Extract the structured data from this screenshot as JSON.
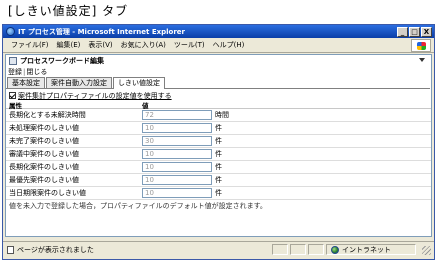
{
  "caption": "[しきい値設定] タブ",
  "window": {
    "title": "IT プロセス管理 - Microsoft Internet Explorer",
    "minimize": "_",
    "maximize": "□",
    "close": "X"
  },
  "menu": [
    "ファイル(F)",
    "編集(E)",
    "表示(V)",
    "お気に入り(A)",
    "ツール(T)",
    "ヘルプ(H)"
  ],
  "editor": {
    "title": "プロセスワークボード編集",
    "register_label": "登録",
    "close_label": "閉じる"
  },
  "tabs": [
    "基本設定",
    "案件自動入力設定",
    "しきい値設定"
  ],
  "option": {
    "checked": true,
    "label": "案件集計プロパティファイルの設定値を使用する"
  },
  "table": {
    "col_attribute": "属性",
    "col_value": "値",
    "rows": [
      {
        "name": "長期化とする未解決時間",
        "value": "72",
        "unit": "時間"
      },
      {
        "name": "未処理案件のしきい値",
        "value": "10",
        "unit": "件"
      },
      {
        "name": "未完了案件のしきい値",
        "value": "30",
        "unit": "件"
      },
      {
        "name": "審議中案件のしきい値",
        "value": "10",
        "unit": "件"
      },
      {
        "name": "長期化案件のしきい値",
        "value": "10",
        "unit": "件"
      },
      {
        "name": "最優先案件のしきい値",
        "value": "10",
        "unit": "件"
      },
      {
        "name": "当日期限案件のしきい値",
        "value": "10",
        "unit": "件"
      }
    ]
  },
  "note": "値を未入力で登録した場合，プロパティファイルのデフォルト値が設定されます。",
  "status": {
    "text": "ページが表示されました",
    "zone": "イントラネット"
  },
  "colors": {
    "title_bar": "#0a3ea8",
    "chrome": "#ece9d8",
    "field_border": "#7f9db9"
  }
}
